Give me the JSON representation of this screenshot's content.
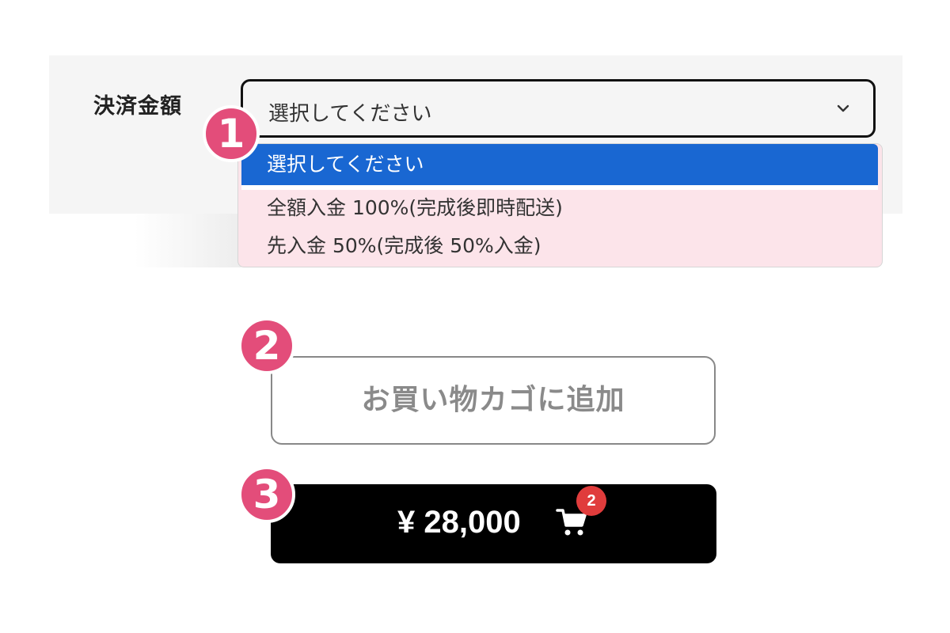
{
  "payment_field": {
    "label": "決済金額",
    "current_value": "選択してください",
    "options": [
      "選択してください",
      "全額入金 100%(完成後即時配送)",
      "先入金 50%(完成後 50%入金)"
    ]
  },
  "steps": [
    "1",
    "2",
    "3"
  ],
  "add_to_cart": {
    "label": "お買い物カゴに追加"
  },
  "cart_button": {
    "price": "¥ 28,000",
    "item_count": "2"
  },
  "colors": {
    "accent": "#e34d7a",
    "selected_option": "#1967d2",
    "dropdown_bg": "#fce4ea",
    "cart_button_bg": "#000000",
    "cart_badge": "#e03c3c"
  },
  "icons": {
    "select_chevron": "chevron-down-icon",
    "cart": "shopping-cart-icon"
  }
}
